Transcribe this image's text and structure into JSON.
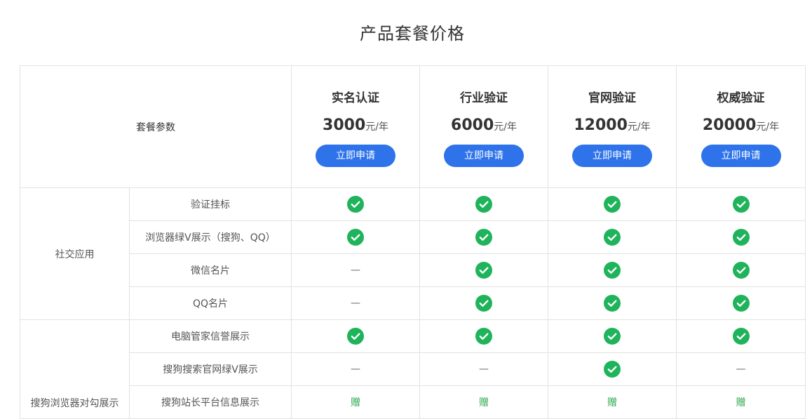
{
  "page": {
    "title": "产品套餐价格"
  },
  "table": {
    "params_label": "套餐参数",
    "plans": [
      {
        "name": "实名认证",
        "price": "3000",
        "unit": "元/年",
        "button": "立即申请"
      },
      {
        "name": "行业验证",
        "price": "6000",
        "unit": "元/年",
        "button": "立即申请"
      },
      {
        "name": "官网验证",
        "price": "12000",
        "unit": "元/年",
        "button": "立即申请"
      },
      {
        "name": "权威验证",
        "price": "20000",
        "unit": "元/年",
        "button": "立即申请"
      }
    ],
    "groups": [
      {
        "label": "社交应用",
        "features": [
          {
            "label": "验证挂标",
            "values": [
              "check",
              "check",
              "check",
              "check"
            ]
          },
          {
            "label": "浏览器绿V展示（搜狗、QQ）",
            "values": [
              "check",
              "check",
              "check",
              "check"
            ]
          },
          {
            "label": "微信名片",
            "values": [
              "—",
              "check",
              "check",
              "check"
            ]
          },
          {
            "label": "QQ名片",
            "values": [
              "—",
              "check",
              "check",
              "check"
            ]
          }
        ]
      },
      {
        "label": "搜狗浏览器对勾展示",
        "features": [
          {
            "label": "电脑管家信誉展示",
            "values": [
              "check",
              "check",
              "check",
              "check"
            ]
          },
          {
            "label": "搜狗搜索官网绿V展示",
            "values": [
              "—",
              "—",
              "check",
              "—"
            ]
          },
          {
            "label": "搜狗站长平台信息展示",
            "values": [
              "赠",
              "赠",
              "赠",
              "赠"
            ]
          }
        ]
      }
    ],
    "icons": {
      "check": "check-circle-icon"
    },
    "colors": {
      "button": "#2e73ea",
      "check": "#1fb35b",
      "gift": "#2aa84a",
      "border": "#e2e2e2"
    }
  }
}
